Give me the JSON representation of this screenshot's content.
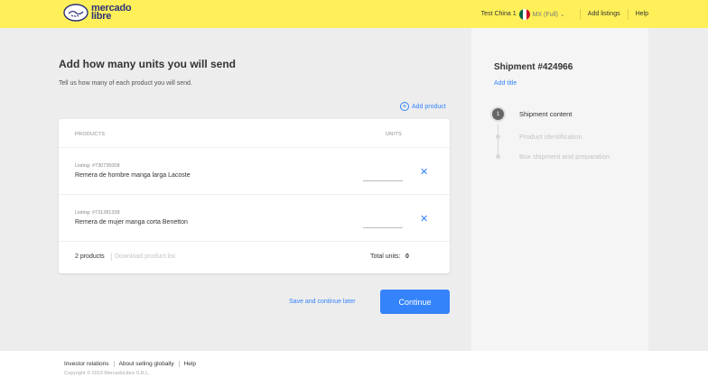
{
  "header": {
    "logo": {
      "line1": "mercado",
      "line2": "libre"
    },
    "account_name": "Test China 1",
    "account_country": "MX (Full) ⌄",
    "add_listings": "Add listings",
    "help": "Help",
    "colors": {
      "bar": "#fff059",
      "brand_blue": "#2d3277"
    }
  },
  "main": {
    "title": "Add how many units you will send",
    "subtitle": "Tell us how many of each product you will send.",
    "add_product": "Add product",
    "table": {
      "headers": {
        "products": "PRODUCTS",
        "units": "UNITS"
      },
      "rows": [
        {
          "listing": "Listing: #730735008",
          "name": "Remera de hombre manga larga Lacoste",
          "units": ""
        },
        {
          "listing": "Listing: #731281338",
          "name": "Remera de mujer manga corta Benetton",
          "units": ""
        }
      ],
      "footer": {
        "count": "2 products",
        "download": "Download product list",
        "total_label": "Total units:",
        "total_value": "0"
      }
    },
    "save_later": "Save and continue later",
    "continue": "Continue",
    "accent": "#3483fa"
  },
  "sidebar": {
    "shipment_title": "Shipment #424966",
    "add_title": "Add title",
    "steps": [
      {
        "number": "1",
        "label": "Shipment content",
        "active": true
      },
      {
        "label": "Product identification",
        "active": false
      },
      {
        "label": "Box shipment and preparation",
        "active": false
      }
    ]
  },
  "footer": {
    "links": [
      "Investor relations",
      "About selling globally",
      "Help"
    ],
    "copyright": "Copyright © 2019 MercadoLibre S.R.L."
  }
}
